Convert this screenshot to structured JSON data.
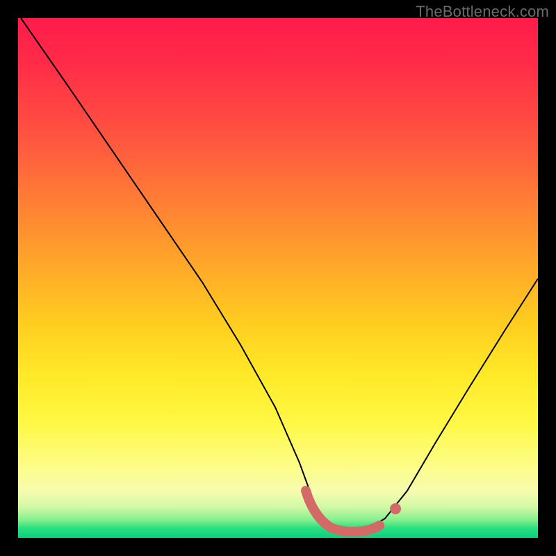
{
  "watermark": "TheBottleneck.com",
  "colors": {
    "background": "#000000",
    "gradient_top": "#ff1b4a",
    "gradient_mid": "#ffe826",
    "gradient_bottom": "#09d07c",
    "curve": "#000000",
    "marker": "#d46a67"
  },
  "chart_data": {
    "type": "line",
    "title": "",
    "xlabel": "",
    "ylabel": "",
    "xlim": [
      0,
      100
    ],
    "ylim": [
      0,
      100
    ],
    "series": [
      {
        "name": "bottleneck-curve",
        "x": [
          0,
          7,
          14,
          21,
          28,
          35,
          42,
          49,
          54,
          57,
          60,
          64,
          68,
          72,
          77,
          83,
          90,
          100
        ],
        "y": [
          100,
          88,
          76,
          64,
          52,
          40,
          28,
          16,
          6,
          2,
          1,
          1,
          2,
          5,
          12,
          22,
          34,
          52
        ]
      }
    ],
    "marker": {
      "name": "optimum-band",
      "x_range": [
        54,
        68
      ],
      "y": 1,
      "extra_dot_x": 72
    },
    "annotations": []
  }
}
